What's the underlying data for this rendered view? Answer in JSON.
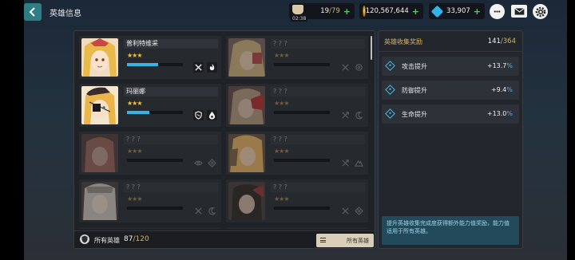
{
  "header": {
    "title": "英雄信息"
  },
  "resources": {
    "stamina_value": "19",
    "stamina_max": "/79",
    "stamina_timer": "02:38",
    "gold": "120,567,644",
    "gems": "33,907",
    "plus_label": "+"
  },
  "heroes": [
    {
      "name": "普利特维采",
      "stars": "★★★",
      "locked": false,
      "progress": 0.55
    },
    {
      "name": "? ? ?",
      "stars": "★★★",
      "locked": true
    },
    {
      "name": "玛丽娜",
      "stars": "★★★",
      "locked": false,
      "progress": 0.4
    },
    {
      "name": "? ? ?",
      "stars": "★★★",
      "locked": true
    },
    {
      "name": "? ? ?",
      "stars": "★★★",
      "locked": true
    },
    {
      "name": "? ? ?",
      "stars": "★★★",
      "locked": true
    },
    {
      "name": "? ? ?",
      "stars": "★★★",
      "locked": true
    },
    {
      "name": "? ? ?",
      "stars": "★★★",
      "locked": true
    }
  ],
  "footer": {
    "all_label": "所有英雄",
    "count": "87",
    "total": "/120",
    "filter_label": "所有英雄"
  },
  "reward": {
    "title": "英雄收集奖励",
    "count": "141",
    "total": "/364",
    "stats": [
      {
        "label": "攻击提升",
        "value": "+13.7",
        "unit": "%"
      },
      {
        "label": "防御提升",
        "value": "+9.4",
        "unit": "%"
      },
      {
        "label": "生命提升",
        "value": "+13.0",
        "unit": "%"
      }
    ],
    "description": "提升英雄收集完成度获得额外能力值奖励，能力值适用于所有英雄。"
  },
  "colors": {
    "accent": "#36b4e5",
    "gold_text": "#d9b45a",
    "back_button": "#2f7e86"
  }
}
